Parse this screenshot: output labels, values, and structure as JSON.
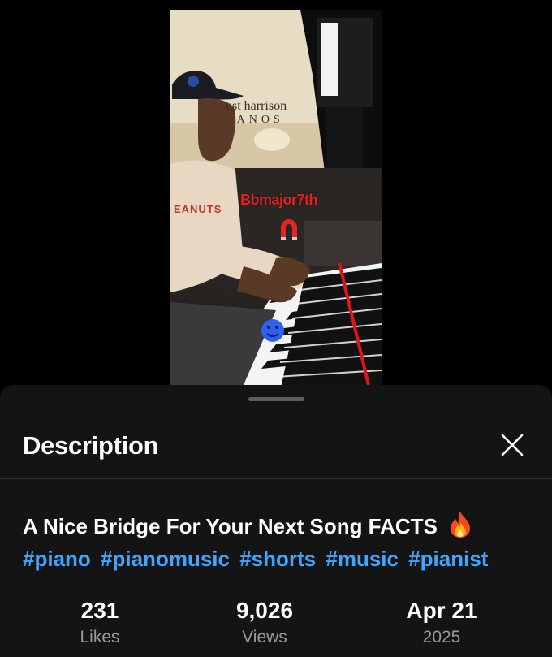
{
  "video": {
    "overlay": {
      "brand_line1": "ust harrison",
      "brand_line2": "IANOS",
      "chord_label": "Bbmajor7th",
      "shirt_text": "EANUTS"
    }
  },
  "description_panel": {
    "title": "Description",
    "close_icon": "close-icon",
    "video_title": "A Nice Bridge For Your Next Song FACTS",
    "title_emoji": "fire-icon",
    "hashtags": [
      "#piano",
      "#pianomusic",
      "#shorts",
      "#music",
      "#pianist"
    ],
    "hashtag_color": "#3ea6ff",
    "stats": {
      "likes": {
        "value": "231",
        "label": "Likes"
      },
      "views": {
        "value": "9,026",
        "label": "Views"
      },
      "date": {
        "value": "Apr 21",
        "label": "2025"
      }
    }
  }
}
